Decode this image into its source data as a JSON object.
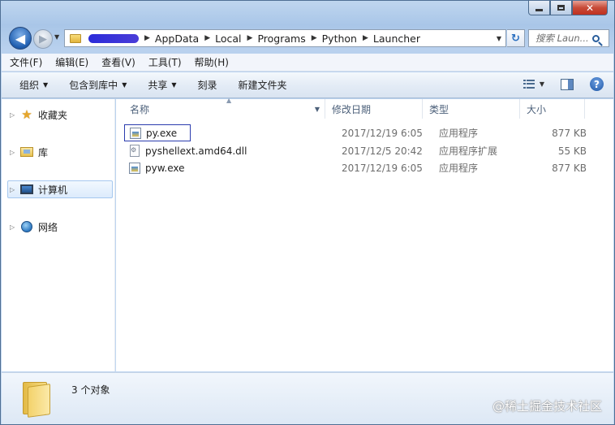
{
  "navigation": {
    "back_glyph": "◀",
    "forward_glyph": "▶",
    "address_crumbs": [
      "AppData",
      "Local",
      "Programs",
      "Python",
      "Launcher"
    ],
    "refresh_glyph": "↻",
    "search_placeholder": "搜索 Laun..."
  },
  "window_controls": {
    "close_glyph": "✕"
  },
  "menu": {
    "items": [
      "文件(F)",
      "编辑(E)",
      "查看(V)",
      "工具(T)",
      "帮助(H)"
    ]
  },
  "toolbar": {
    "buttons": [
      "组织",
      "包含到库中",
      "共享",
      "刻录",
      "新建文件夹"
    ],
    "help_glyph": "?"
  },
  "sidebar": {
    "items": [
      {
        "label": "收藏夹",
        "icon": "star-icon"
      },
      {
        "label": "库",
        "icon": "library-icon"
      },
      {
        "label": "计算机",
        "icon": "computer-icon",
        "selected": true
      },
      {
        "label": "网络",
        "icon": "network-icon"
      }
    ],
    "star_glyph": "★"
  },
  "file_list": {
    "columns": [
      "名称",
      "修改日期",
      "类型",
      "大小"
    ],
    "rows": [
      {
        "name": "py.exe",
        "modified": "2017/12/19 6:05",
        "type": "应用程序",
        "size": "877 KB",
        "icon": "exe-icon",
        "focused": true
      },
      {
        "name": "pyshellext.amd64.dll",
        "modified": "2017/12/5 20:42",
        "type": "应用程序扩展",
        "size": "55 KB",
        "icon": "dll-icon"
      },
      {
        "name": "pyw.exe",
        "modified": "2017/12/19 6:05",
        "type": "应用程序",
        "size": "877 KB",
        "icon": "exe-icon"
      }
    ]
  },
  "details": {
    "count_text": "3 个对象",
    "watermark": "@稀土掘金技术社区"
  },
  "colors": {
    "frame": "#a9c6e8",
    "selection_border": "#2b3cae",
    "secondary_text": "#6d6d6d"
  }
}
